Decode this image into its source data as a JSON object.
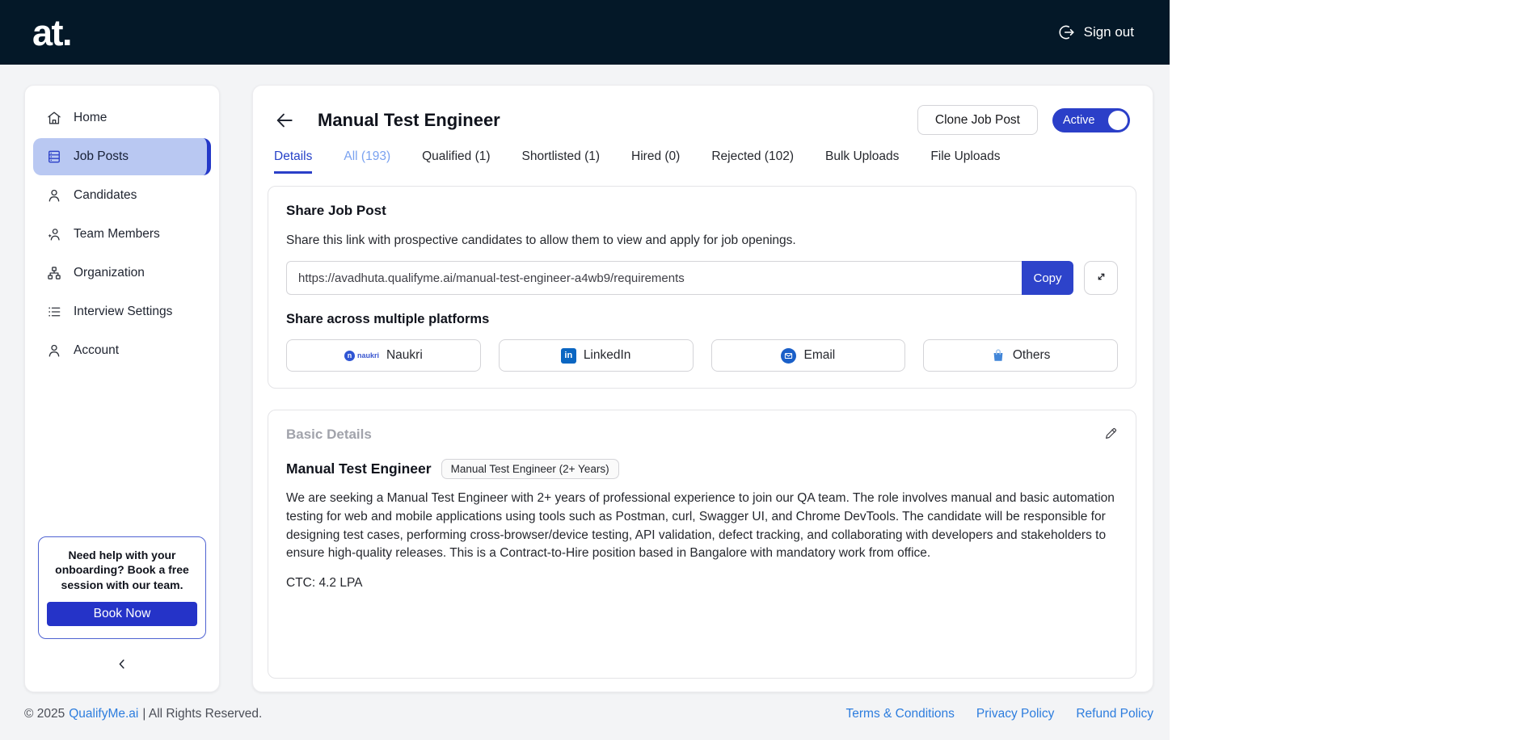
{
  "header": {
    "logo": "at.",
    "sign_out_label": "Sign out"
  },
  "sidebar": {
    "items": [
      {
        "label": "Home",
        "icon": "home-icon",
        "active": false
      },
      {
        "label": "Job Posts",
        "icon": "job-posts-icon",
        "active": true
      },
      {
        "label": "Candidates",
        "icon": "candidates-icon",
        "active": false
      },
      {
        "label": "Team Members",
        "icon": "team-members-icon",
        "active": false
      },
      {
        "label": "Organization",
        "icon": "organization-icon",
        "active": false
      },
      {
        "label": "Interview Settings",
        "icon": "interview-settings-icon",
        "active": false
      },
      {
        "label": "Account",
        "icon": "account-icon",
        "active": false
      }
    ],
    "help_box": {
      "text": "Need help with your onboarding? Book a free session with our team.",
      "button_label": "Book Now"
    }
  },
  "main": {
    "title": "Manual Test Engineer",
    "clone_button_label": "Clone Job Post",
    "status_toggle": {
      "label": "Active",
      "state": "on"
    },
    "tabs": [
      {
        "label": "Details",
        "state": "active"
      },
      {
        "label": "All (193)",
        "state": "highlight"
      },
      {
        "label": "Qualified (1)",
        "state": "default"
      },
      {
        "label": "Shortlisted (1)",
        "state": "default"
      },
      {
        "label": "Hired (0)",
        "state": "default"
      },
      {
        "label": "Rejected (102)",
        "state": "default"
      },
      {
        "label": "Bulk Uploads",
        "state": "default"
      },
      {
        "label": "File Uploads",
        "state": "default"
      }
    ],
    "share": {
      "title": "Share Job Post",
      "description": "Share this link with prospective candidates to allow them to view and apply for job openings.",
      "link": "https://avadhuta.qualifyme.ai/manual-test-engineer-a4wb9/requirements",
      "copy_button_label": "Copy",
      "platforms_title": "Share across multiple platforms",
      "platforms": [
        {
          "label": "Naukri",
          "icon": "naukri-icon"
        },
        {
          "label": "LinkedIn",
          "icon": "linkedin-icon"
        },
        {
          "label": "Email",
          "icon": "email-icon"
        },
        {
          "label": "Others",
          "icon": "others-icon"
        }
      ],
      "naukri_initial": "n",
      "naukri_word": "naukri",
      "linkedin_initials": "in"
    },
    "basic_details": {
      "title": "Basic Details",
      "job_title": "Manual Test Engineer",
      "job_badge": "Manual Test Engineer (2+ Years)",
      "description": "We are seeking a Manual Test Engineer with 2+ years of professional experience to join our QA team. The role involves manual and basic automation testing for web and mobile applications using tools such as Postman, curl, Swagger UI, and Chrome DevTools. The candidate will be responsible for designing test cases, performing cross-browser/device testing, API validation, defect tracking, and collaborating with developers and stakeholders to ensure high-quality releases. This is a Contract-to-Hire position based in Bangalore with mandatory work from office.",
      "ctc": "CTC: 4.2 LPA"
    }
  },
  "footer": {
    "copyright_prefix": "© 2025",
    "brand_link": "QualifyMe.ai",
    "copyright_suffix": "| All Rights Reserved.",
    "links": [
      "Terms & Conditions",
      "Privacy Policy",
      "Refund Policy"
    ]
  },
  "colors": {
    "topbar_bg": "#041828",
    "accent_blue": "#2b3fc8",
    "active_nav_bg": "#b9c8f2",
    "active_tab": "#2742c8",
    "highlight_tab": "#7aa2f0",
    "footer_link": "#2d7dde",
    "linkedin_blue": "#0a66c2",
    "body_bg": "#f3f4f6"
  }
}
